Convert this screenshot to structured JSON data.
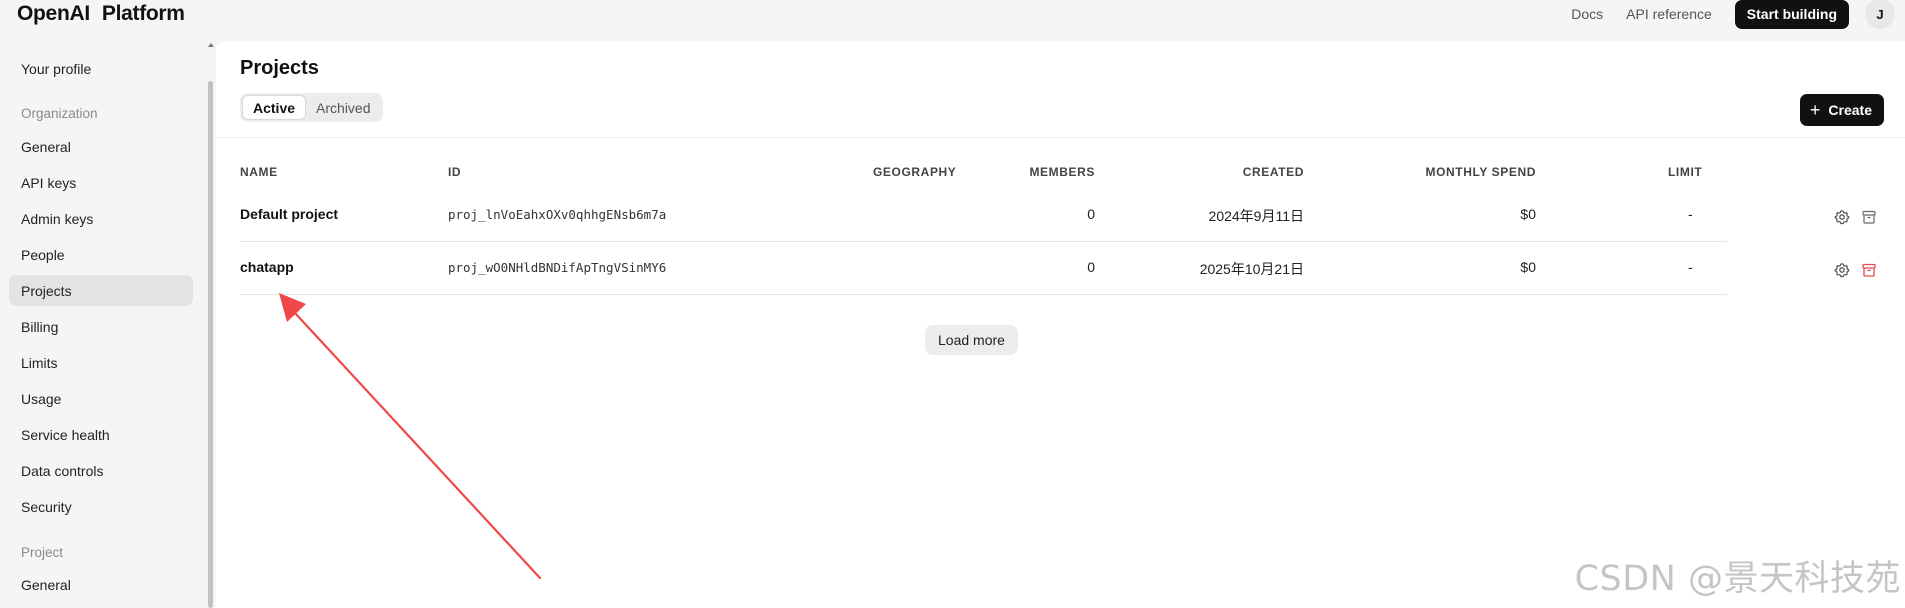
{
  "header": {
    "brand_primary": "OpenAI",
    "brand_secondary": "Platform",
    "nav": [
      "Docs",
      "API reference"
    ],
    "cta_label": "Start building",
    "avatar_initial": "J"
  },
  "sidebar": {
    "top_item": "Your profile",
    "org_section": "Organization",
    "org_items": [
      "General",
      "API keys",
      "Admin keys",
      "People",
      "Projects",
      "Billing",
      "Limits",
      "Usage",
      "Service health",
      "Data controls",
      "Security"
    ],
    "active_item": "Projects",
    "project_section": "Project",
    "project_items": [
      "General"
    ]
  },
  "main": {
    "title": "Projects",
    "tabs": [
      {
        "label": "Active",
        "selected": true
      },
      {
        "label": "Archived",
        "selected": false
      }
    ],
    "create_label": "Create",
    "table": {
      "columns": [
        "NAME",
        "ID",
        "GEOGRAPHY",
        "MEMBERS",
        "CREATED",
        "MONTHLY SPEND",
        "LIMIT"
      ],
      "rows": [
        {
          "name": "Default project",
          "id": "proj_lnVoEahxOXv0qhhgENsb6m7a",
          "geography": "",
          "members": "0",
          "created": "2024年9月11日",
          "spend": "$0",
          "limit": "-"
        },
        {
          "name": "chatapp",
          "id": "proj_wO0NHldBNDifApTngVSinMY6",
          "geography": "",
          "members": "0",
          "created": "2025年10月21日",
          "spend": "$0",
          "limit": "-"
        }
      ]
    },
    "load_more_label": "Load more"
  },
  "watermark": "CSDN @景天科技苑",
  "colors": {
    "accent_dark": "#111111",
    "annotation_red": "#f04848",
    "archive_red": "#e5484d"
  }
}
